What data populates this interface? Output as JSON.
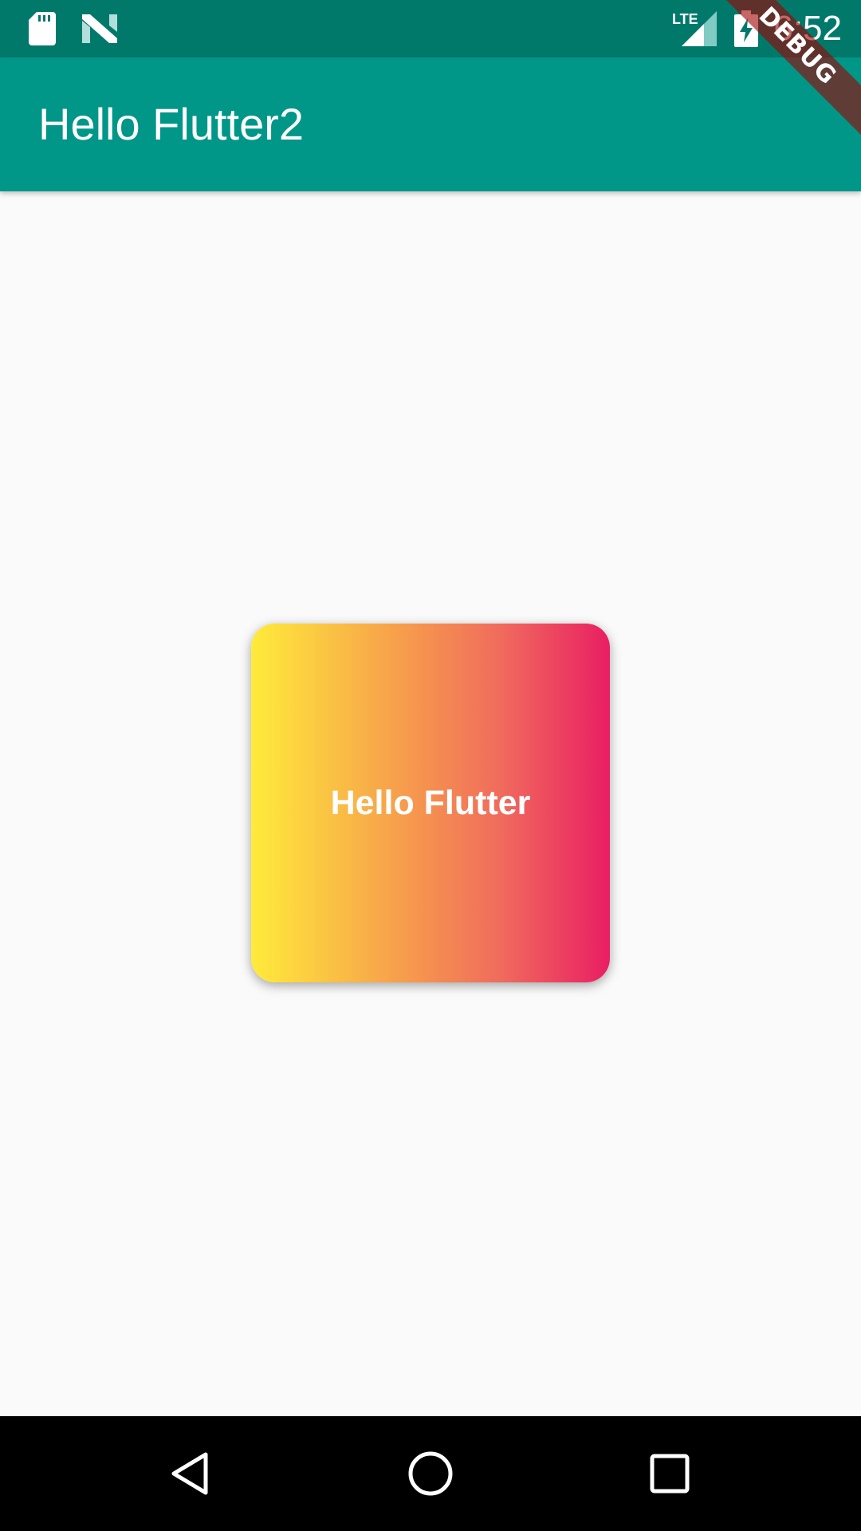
{
  "status_bar": {
    "time": "6:52",
    "network_label": "LTE",
    "icons": [
      "sd-card-icon",
      "n-icon",
      "lte-signal-icon",
      "battery-charging-icon"
    ]
  },
  "app_bar": {
    "title": "Hello Flutter2"
  },
  "debug_banner": {
    "label": "DEBUG"
  },
  "card": {
    "text": "Hello Flutter",
    "gradient_colors": [
      "#ffeb3b",
      "#e91e63"
    ]
  },
  "nav_bar": {
    "icons": [
      "back-icon",
      "home-icon",
      "recents-icon"
    ]
  },
  "colors": {
    "status_bar": "#00796b",
    "app_bar": "#009688",
    "background": "#fafafa",
    "nav_bar": "#000000"
  }
}
